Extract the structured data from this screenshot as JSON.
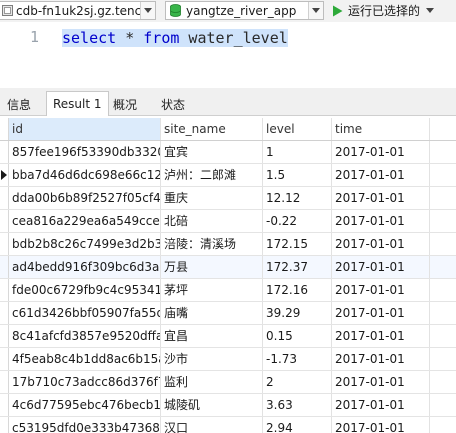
{
  "toolbar": {
    "connection": "cdb-fn1uk2sj.gz.tenc",
    "database": "yangtze_river_app",
    "run_label": "运行已选择的"
  },
  "editor": {
    "line_number": "1",
    "sql_keyword_select": "select",
    "sql_star": " * ",
    "sql_keyword_from": "from",
    "sql_table": " water_level"
  },
  "tabs": [
    {
      "label": "信息"
    },
    {
      "label": "Result 1"
    },
    {
      "label": "概况"
    },
    {
      "label": "状态"
    }
  ],
  "grid": {
    "columns": [
      "id",
      "site_name",
      "level",
      "time"
    ],
    "rows": [
      {
        "id": "857fee196f53390db33206",
        "site_name": "宜宾",
        "level": "1",
        "time": "2017-01-01"
      },
      {
        "id": "bba7d46d6dc698e66c12f",
        "site_name": "泸州：二郎滩",
        "level": "1.5",
        "time": "2017-01-01"
      },
      {
        "id": "dda00b6b89f2527f05cf48",
        "site_name": "重庆",
        "level": "12.12",
        "time": "2017-01-01"
      },
      {
        "id": "cea816a229ea6a549ccea5",
        "site_name": "北碚",
        "level": "-0.22",
        "time": "2017-01-01"
      },
      {
        "id": "bdb2b8c26c7499e3d2b3f",
        "site_name": "涪陵：清溪场",
        "level": "172.15",
        "time": "2017-01-01"
      },
      {
        "id": "ad4bedd916f309bc6d3a9",
        "site_name": "万县",
        "level": "172.37",
        "time": "2017-01-01"
      },
      {
        "id": "fde00c6729fb9c4c953418",
        "site_name": "茅坪",
        "level": "172.16",
        "time": "2017-01-01"
      },
      {
        "id": "c61d3426bbf05907fa55d6",
        "site_name": "庙嘴",
        "level": "39.29",
        "time": "2017-01-01"
      },
      {
        "id": "8c41afcfd3857e9520dffa0",
        "site_name": "宜昌",
        "level": "0.15",
        "time": "2017-01-01"
      },
      {
        "id": "4f5eab8c4b1dd8ac6b15a",
        "site_name": "沙市",
        "level": "-1.73",
        "time": "2017-01-01"
      },
      {
        "id": "17b710c73adcc86d376f79",
        "site_name": "监利",
        "level": "2",
        "time": "2017-01-01"
      },
      {
        "id": "4c6d77595ebc476becb11",
        "site_name": "城陵矶",
        "level": "3.63",
        "time": "2017-01-01"
      },
      {
        "id": "c53195dfd0e333b473687",
        "site_name": "汉口",
        "level": "2.94",
        "time": "2017-01-01"
      }
    ]
  },
  "colors": {
    "selection": "#cfe3fb",
    "keyword": "#0000cc",
    "run_icon": "#2eaa3a",
    "db_icon": "#2eaa3a",
    "sorted_header": "#dcebfb"
  },
  "icons": {
    "connection": "connection-icon",
    "database": "database-icon",
    "run": "run-play-icon",
    "dropdown": "chevron-down-icon",
    "current_row": "current-row-marker-icon"
  }
}
